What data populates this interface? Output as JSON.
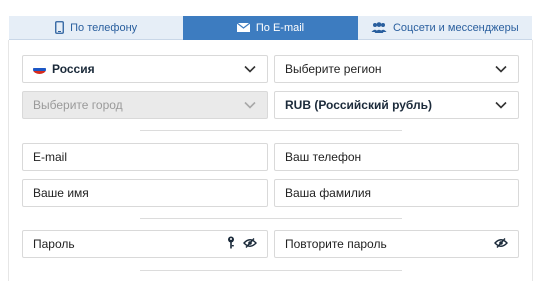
{
  "tabs": [
    {
      "label": "По телефону",
      "icon": "phone-icon",
      "active": false
    },
    {
      "label": "По E-mail",
      "icon": "envelope-icon",
      "active": true
    },
    {
      "label": "Соцсети и мессенджеры",
      "icon": "users-icon",
      "active": false
    }
  ],
  "form": {
    "country": {
      "value": "Россия",
      "icon": "russia-flag-icon"
    },
    "region": {
      "placeholder": "Выберите регион"
    },
    "city": {
      "placeholder": "Выберите город",
      "disabled": true
    },
    "currency": {
      "value": "RUB (Российский рубль)"
    },
    "email": {
      "placeholder": "E-mail"
    },
    "phone": {
      "placeholder": "Ваш телефон"
    },
    "first_name": {
      "placeholder": "Ваше имя"
    },
    "last_name": {
      "placeholder": "Ваша фамилия"
    },
    "password": {
      "placeholder": "Пароль"
    },
    "password_repeat": {
      "placeholder": "Повторите пароль"
    }
  },
  "colors": {
    "tab_active_bg": "#3d7cc0",
    "tab_bg": "#e6eef7",
    "tab_text": "#2a5f9e",
    "field_border": "#d9d9d9",
    "disabled_bg": "#eaeaea"
  }
}
